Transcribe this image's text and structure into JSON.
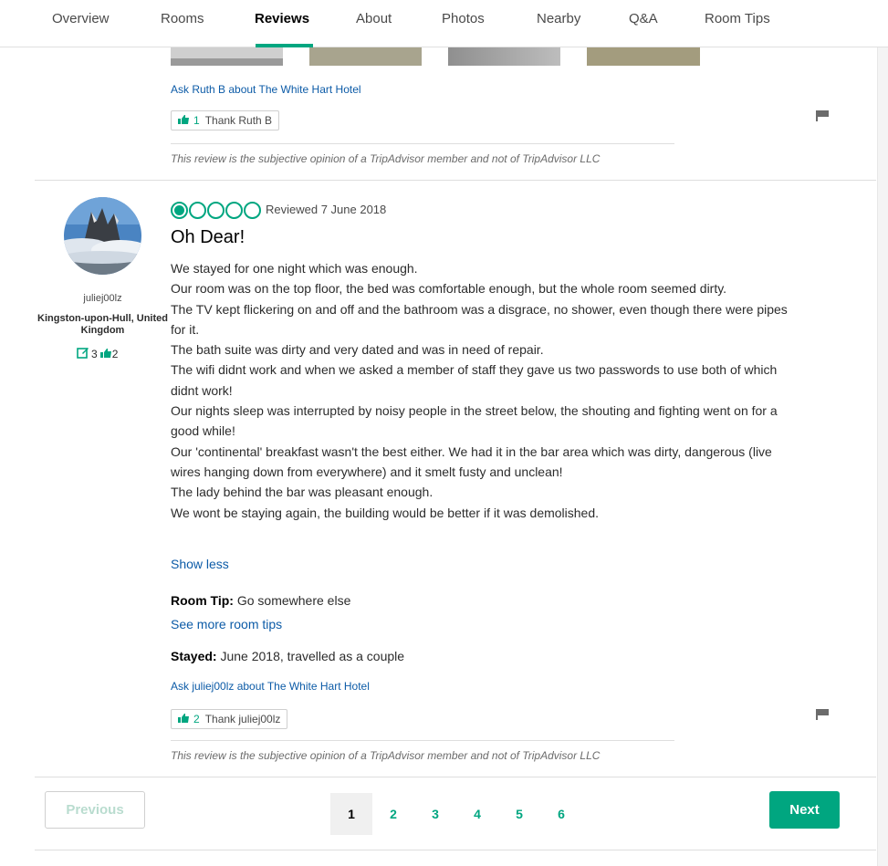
{
  "nav": {
    "tabs": [
      {
        "label": "Overview"
      },
      {
        "label": "Rooms"
      },
      {
        "label": "Reviews",
        "active": true
      },
      {
        "label": "About"
      },
      {
        "label": "Photos"
      },
      {
        "label": "Nearby"
      },
      {
        "label": "Q&A"
      },
      {
        "label": "Room Tips"
      }
    ]
  },
  "previous_review": {
    "ask_link": "Ask Ruth B about The White Hart Hotel",
    "thank": {
      "count": "1",
      "label": "Thank Ruth B"
    },
    "disclaimer": "This review is the subjective opinion of a TripAdvisor member and not of TripAdvisor LLC"
  },
  "review": {
    "member": {
      "username": "juliej00lz",
      "location": "Kingston-upon-Hull, United Kingdom",
      "review_count": "3",
      "helpful_votes": "2"
    },
    "rating": 1,
    "rating_max": 5,
    "reviewed_date": "Reviewed 7 June 2018",
    "title": "Oh Dear!",
    "body": [
      "We stayed for one night which was enough.",
      "Our room was on the top floor, the bed was comfortable enough, but the whole room seemed dirty.",
      "The TV kept flickering on and off and the bathroom was a disgrace, no shower, even though there were pipes for it.",
      "The bath suite was dirty and very dated and was in need of repair.",
      "The wifi didnt work and when we asked a member of staff they gave us two passwords to use both of which didnt work!",
      "Our nights sleep was interrupted by noisy people in the street below, the shouting and fighting went on for a good while!",
      "Our 'continental' breakfast wasn't the best either. We had it in the bar area which was dirty, dangerous (live wires hanging down from everywhere) and it smelt fusty and unclean!",
      "The lady behind the bar was pleasant enough.",
      "We wont be staying again, the building would be better if it was demolished."
    ],
    "show_less": "Show less",
    "room_tip_label": "Room Tip:",
    "room_tip_text": " Go somewhere else",
    "see_more_tips": "See more room tips",
    "stayed_label": "Stayed:",
    "stayed_text": " June 2018, travelled as a couple",
    "ask_link": "Ask juliej00lz about The White Hart Hotel",
    "thank": {
      "count": "2",
      "label": "Thank juliej00lz"
    },
    "disclaimer": "This review is the subjective opinion of a TripAdvisor member and not of TripAdvisor LLC"
  },
  "pagination": {
    "previous": "Previous",
    "next": "Next",
    "pages": [
      "1",
      "2",
      "3",
      "4",
      "5",
      "6"
    ],
    "current": "1"
  },
  "colors": {
    "accent": "#00a680",
    "link": "#0c5ba7"
  }
}
